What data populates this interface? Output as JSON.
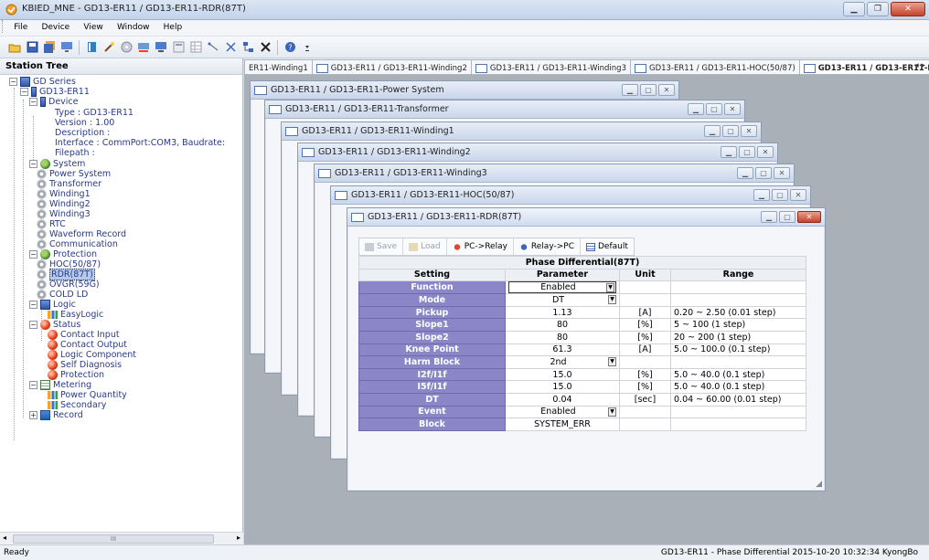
{
  "window": {
    "title": "KBIED_MNE - GD13-ER11 / GD13-ER11-RDR(87T)"
  },
  "menu": [
    "File",
    "Device",
    "View",
    "Window",
    "Help"
  ],
  "tree": {
    "header": "Station Tree",
    "nodes": {
      "root": "GD Series",
      "device_group": "GD13-ER11",
      "device": "Device",
      "type": "Type : GD13-ER11",
      "version": "Version : 1.00",
      "description": "Description :",
      "interface": "Interface : CommPort:COM3, Baudrate:",
      "filepath": "Filepath :",
      "system": "System",
      "power_system": "Power System",
      "transformer": "Transformer",
      "winding1": "Winding1",
      "winding2": "Winding2",
      "winding3": "Winding3",
      "rtc": "RTC",
      "waveform_record": "Waveform Record",
      "communication": "Communication",
      "protection": "Protection",
      "hoc": "HOC(50/87)",
      "rdr": "RDR(87T)",
      "ovgr": "OVGR(59G)",
      "cold_ld": "COLD LD",
      "logic": "Logic",
      "easylogic": "EasyLogic",
      "status": "Status",
      "contact_input": "Contact Input",
      "contact_output": "Contact Output",
      "logic_component": "Logic Component",
      "self_diagnosis": "Self Diagnosis",
      "protection2": "Protection",
      "metering": "Metering",
      "power_quantity": "Power Quantity",
      "secondary": "Secondary",
      "record": "Record"
    },
    "scroll_label": "III"
  },
  "tabs": [
    "ER11-Winding1",
    "GD13-ER11 / GD13-ER11-Winding2",
    "GD13-ER11 / GD13-ER11-Winding3",
    "GD13-ER11 / GD13-ER11-HOC(50/87)",
    "GD13-ER11 / GD13-ER11-RDR(8..."
  ],
  "windows": [
    "GD13-ER11 / GD13-ER11-Power System",
    "GD13-ER11 / GD13-ER11-Transformer",
    "GD13-ER11 / GD13-ER11-Winding1",
    "GD13-ER11 / GD13-ER11-Winding2",
    "GD13-ER11 / GD13-ER11-Winding3",
    "GD13-ER11 / GD13-ER11-HOC(50/87)",
    "GD13-ER11 / GD13-ER11-RDR(87T)"
  ],
  "panel": {
    "toolbar": {
      "save": "Save",
      "load": "Load",
      "pc_relay": "PC->Relay",
      "relay_pc": "Relay->PC",
      "default": "Default"
    },
    "caption": "Phase Differential(87T)",
    "headers": {
      "setting": "Setting",
      "parameter": "Parameter",
      "unit": "Unit",
      "range": "Range"
    },
    "rows": [
      {
        "setting": "Function",
        "parameter": "Enabled",
        "unit": "",
        "range": ""
      },
      {
        "setting": "Mode",
        "parameter": "DT",
        "unit": "",
        "range": ""
      },
      {
        "setting": "Pickup",
        "parameter": "1.13",
        "unit": "[A]",
        "range": "0.20 ~ 2.50 (0.01 step)"
      },
      {
        "setting": "Slope1",
        "parameter": "80",
        "unit": "[%]",
        "range": "5 ~ 100 (1 step)"
      },
      {
        "setting": "Slope2",
        "parameter": "80",
        "unit": "[%]",
        "range": "20 ~ 200 (1 step)"
      },
      {
        "setting": "Knee Point",
        "parameter": "61.3",
        "unit": "[A]",
        "range": "5.0 ~ 100.0 (0.1 step)"
      },
      {
        "setting": "Harm Block",
        "parameter": "2nd",
        "unit": "",
        "range": ""
      },
      {
        "setting": "I2f/I1f",
        "parameter": "15.0",
        "unit": "[%]",
        "range": "5.0 ~ 40.0 (0.1 step)"
      },
      {
        "setting": "I5f/I1f",
        "parameter": "15.0",
        "unit": "[%]",
        "range": "5.0 ~ 40.0 (0.1 step)"
      },
      {
        "setting": "DT",
        "parameter": "0.04",
        "unit": "[sec]",
        "range": "0.04 ~ 60.00 (0.01 step)"
      },
      {
        "setting": "Event",
        "parameter": "Enabled",
        "unit": "",
        "range": ""
      },
      {
        "setting": "Block",
        "parameter": "SYSTEM_ERR",
        "unit": "",
        "range": ""
      }
    ]
  },
  "status": {
    "left": "Ready",
    "right": "GD13-ER11 - Phase Differential  2015-10-20 10:32:34  KyongBo"
  }
}
